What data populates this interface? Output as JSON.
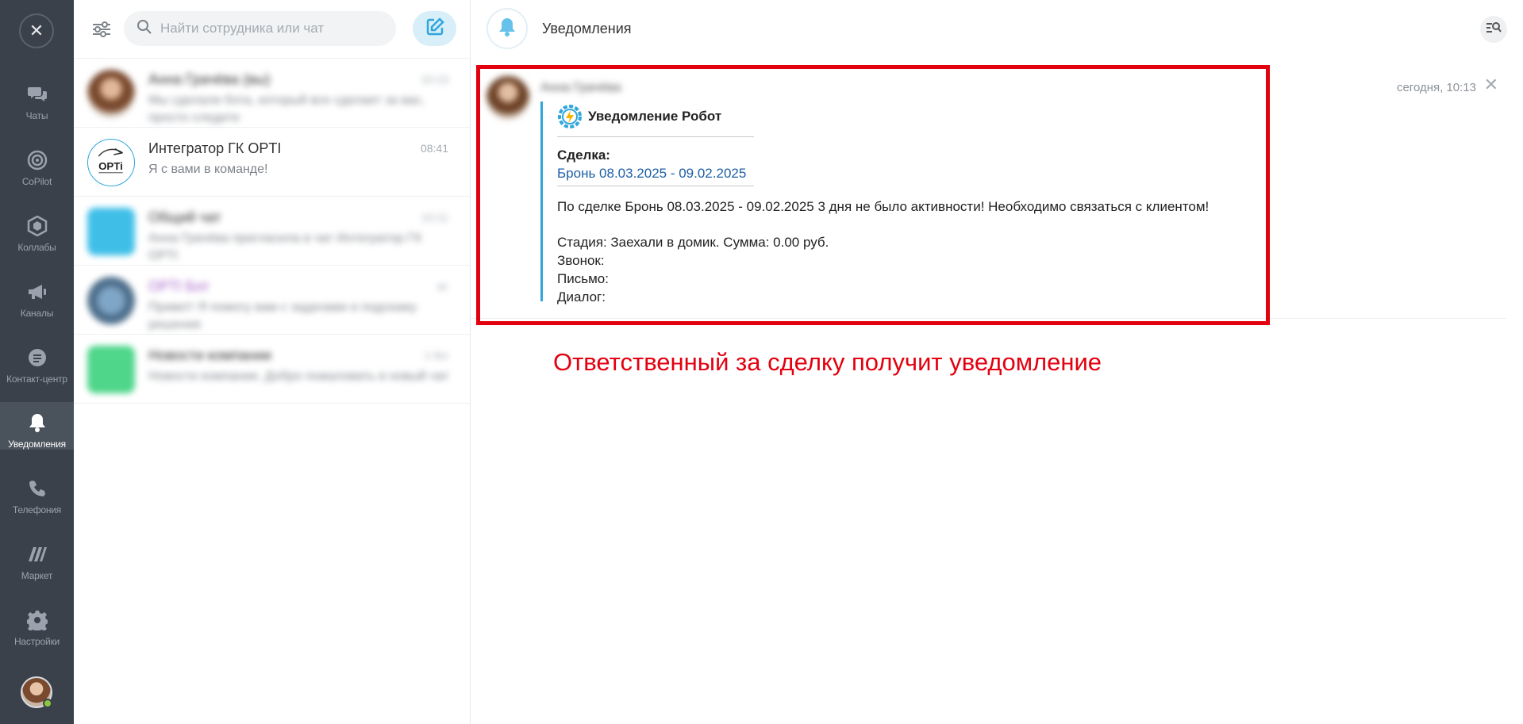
{
  "nav": {
    "items": [
      {
        "label": "Чаты",
        "icon": "chat-bubbles-icon"
      },
      {
        "label": "CoPilot",
        "icon": "copilot-icon"
      },
      {
        "label": "Коллабы",
        "icon": "hexagon-icon"
      },
      {
        "label": "Каналы",
        "icon": "megaphone-icon"
      },
      {
        "label": "Контакт-центр",
        "icon": "contact-center-icon"
      },
      {
        "label": "Уведомления",
        "icon": "bell-icon"
      },
      {
        "label": "Телефония",
        "icon": "phone-icon"
      },
      {
        "label": "Маркет",
        "icon": "market-icon"
      },
      {
        "label": "Настройки",
        "icon": "gear-icon"
      }
    ]
  },
  "search": {
    "placeholder": "Найти сотрудника или чат"
  },
  "chats": [
    {
      "name": "Анна Грачёва (вы)",
      "time": "10:13",
      "preview": "Мы сделали бота, который все сделает за вас, просто следите",
      "blurred": true
    },
    {
      "name": "Интегратор ГК OPTI",
      "time": "08:41",
      "preview": "Я с вами в команде!",
      "blurred": false
    },
    {
      "name": "Общий чат",
      "time": "10:11",
      "preview": "Анна Грачёва пригласила в чат Интегратор ГК OPTI",
      "blurred": true
    },
    {
      "name": "OPTI Бот",
      "time": "вт",
      "preview": "Привет! Я помогу вам с задачами и подскажу решения",
      "blurred": true
    },
    {
      "name": "Новости компании",
      "time": "1 fev",
      "preview": "Новости компании. Добро пожаловать в новый чат",
      "blurred": true
    }
  ],
  "header": {
    "title": "Уведомления"
  },
  "notification": {
    "sender": "Анна Грачёва",
    "time": "сегодня, 10:13",
    "bot_name": "Уведомление Робот",
    "deal_label": "Сделка:",
    "deal_link": "Бронь 08.03.2025 - 09.02.2025",
    "message": "По сделке Бронь 08.03.2025 - 09.02.2025 3 дня не было активности! Необходимо связаться с клиентом!",
    "stage": "Стадия: Заехали в домик. Сумма: 0.00 руб.",
    "call": "Звонок:",
    "letter": "Письмо:",
    "dialog": "Диалог:"
  },
  "annotation": "Ответственный за сделку получит уведомление",
  "colors": {
    "nav_bg": "#3a414b",
    "accent": "#2fa6dc",
    "link": "#1d5fa5",
    "annotation": "#e3000f",
    "online": "#8cc63f"
  }
}
